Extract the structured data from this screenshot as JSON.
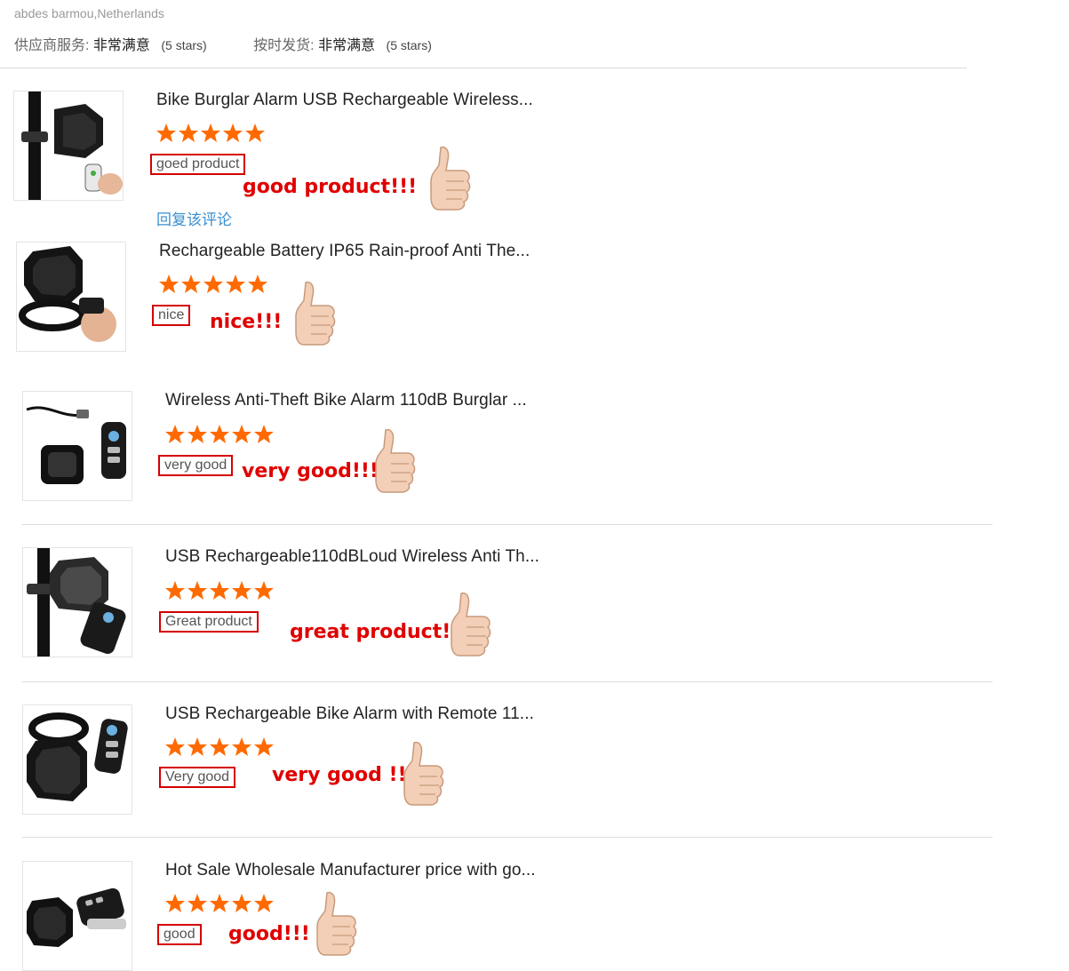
{
  "reviewer": "abdes barmou,Netherlands",
  "ratings": [
    {
      "label": "供应商服务:",
      "value": "非常满意",
      "stars": "(5 stars)"
    },
    {
      "label": "按时发货:",
      "value": "非常满意",
      "stars": "(5 stars)"
    }
  ],
  "reply_link": "回复该评论",
  "colors": {
    "star": "#ff6a00",
    "annotation": "#e00000",
    "box": "#d40000",
    "link": "#3a8fd0"
  },
  "reviews": [
    {
      "title": "Bike Burglar Alarm USB Rechargeable Wireless...",
      "stars": 5,
      "review": "goed product",
      "note": "good product!!!"
    },
    {
      "title": "Rechargeable Battery IP65 Rain-proof Anti The...",
      "stars": 5,
      "review": "nice",
      "note": "nice!!!"
    },
    {
      "title": "Wireless Anti-Theft Bike Alarm 110dB Burglar ...",
      "stars": 5,
      "review": "very good",
      "note": "very good!!!"
    },
    {
      "title": "USB Rechargeable110dBLoud Wireless Anti Th...",
      "stars": 5,
      "review": "Great product",
      "note": "great product!!!"
    },
    {
      "title": "USB Rechargeable Bike Alarm with Remote 11...",
      "stars": 5,
      "review": "Very good",
      "note": "very good !!!"
    },
    {
      "title": "Hot Sale Wholesale Manufacturer price with go...",
      "stars": 5,
      "review": "good",
      "note": "good!!!"
    }
  ]
}
